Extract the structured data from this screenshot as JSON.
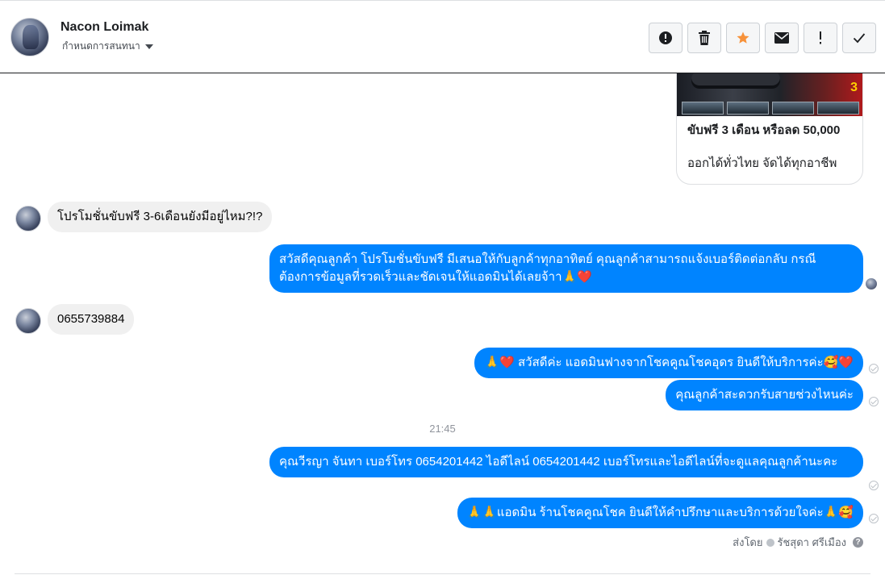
{
  "header": {
    "name": "Nacon Loimak",
    "subtitle": "กำหนดการสนทนา",
    "actions": [
      {
        "icon": "alert-circle-icon"
      },
      {
        "icon": "trash-icon"
      },
      {
        "icon": "star-icon"
      },
      {
        "icon": "envelope-icon"
      },
      {
        "icon": "exclamation-icon",
        "label": "!"
      },
      {
        "icon": "check-icon"
      }
    ]
  },
  "card": {
    "title": "ขับฟรี 3 เดือน หรือลด 50,000",
    "description": "ออกได้ทั่วไทย จัดได้ทุกอาชีพ"
  },
  "messages": [
    {
      "side": "in",
      "text": "โปรโมชั่นขับฟรี 3-6เดือนยังมีอยู่ไหม?!?"
    },
    {
      "side": "out",
      "text": "สวัสดีคุณลูกค้า โปรโมชั่นขับฟรี มีเสนอให้กับลูกค้าทุกอาทิตย์ คุณลูกค้าสามารถแจ้งเบอร์ติดต่อกลับ กรณีต้องการข้อมูลที่รวดเร็วและชัดเจนให้แอดมินได้เลยจ้าา🙏❤️"
    },
    {
      "side": "in",
      "text": "0655739884"
    },
    {
      "side": "out",
      "text": "🙏❤️ สวัสดีค่ะ แอดมินฟางจากโชคคูณโชคอุดร ยินดีให้บริการค่ะ🥰❤️"
    },
    {
      "side": "out",
      "text": "คุณลูกค้าสะดวกรับสายช่วงไหนค่ะ"
    },
    {
      "side": "out",
      "text": "คุณวีรญา จันทา      เบอร์โทร 0654201442  ไอดีไลน์ 0654201442   เบอร์โทรและไอดีไลน์ที่จะดูแลคุณลูกค้านะคะ"
    },
    {
      "side": "out",
      "text": "🙏🙏แอดมิน ร้านโชคคูณโชค ยินดีให้คำปรึกษาและบริการด้วยใจค่ะ🙏🥰"
    }
  ],
  "time_separator": "21:45",
  "sent_by": {
    "label": "ส่งโดย",
    "name": "รัชสุดา ศรีเมือง"
  },
  "colors": {
    "outgoing_bubble": "#0084ff",
    "incoming_bubble": "#f0f0f0",
    "star": "#f7923a"
  }
}
